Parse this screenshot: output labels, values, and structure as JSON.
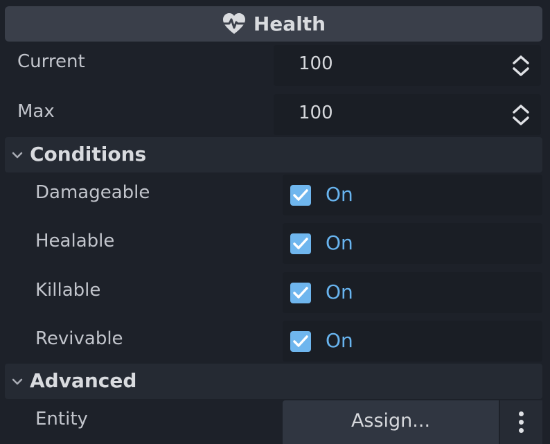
{
  "header": {
    "title": "Health",
    "icon": "heart-pulse-icon"
  },
  "fields": {
    "current": {
      "label": "Current",
      "value": "100"
    },
    "max": {
      "label": "Max",
      "value": "100"
    }
  },
  "conditions": {
    "title": "Conditions",
    "items": [
      {
        "label": "Damageable",
        "checked": true,
        "state": "On"
      },
      {
        "label": "Healable",
        "checked": true,
        "state": "On"
      },
      {
        "label": "Killable",
        "checked": true,
        "state": "On"
      },
      {
        "label": "Revivable",
        "checked": true,
        "state": "On"
      }
    ]
  },
  "advanced": {
    "title": "Advanced",
    "entity": {
      "label": "Entity",
      "button": "Assign..."
    }
  },
  "colors": {
    "background": "#1d2129",
    "accent": "#6fb6ee",
    "header_bg": "#3a3f4a"
  }
}
